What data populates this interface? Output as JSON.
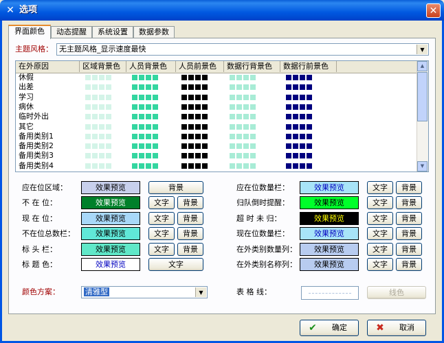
{
  "window": {
    "title": "选项",
    "close": "✕",
    "app_icon": "✕"
  },
  "tabs": [
    "界面颜色",
    "动态提醒",
    "系统设置",
    "数据参数"
  ],
  "theme": {
    "label": "主题风格：",
    "value": "无主题风格_显示速度最快"
  },
  "grid": {
    "columns": [
      "在外原因",
      "区域背景色",
      "人员背景色",
      "人员前景色",
      "数据行背景色",
      "数据行前景色"
    ],
    "rows": [
      "休假",
      "出差",
      "学习",
      "病休",
      "临时外出",
      "其它",
      "备用类别1",
      "备用类别2",
      "备用类别3",
      "备用类别4"
    ],
    "swatch_colors": [
      "#d4f4e8",
      "#33d6a0",
      "#000000",
      "#a8ecd6",
      "#00007f"
    ]
  },
  "left_settings": [
    {
      "label": "应在位区域：",
      "preview": "效果预览",
      "bg": "#c8d0ec",
      "fg": "#000000",
      "buttons": [
        "背景"
      ]
    },
    {
      "label": "不 在 位：",
      "preview": "效果预览",
      "bg": "#00802a",
      "fg": "#ffffff",
      "buttons": [
        "文字",
        "背景"
      ]
    },
    {
      "label": "现 在 位：",
      "preview": "效果预览",
      "bg": "#a8d8f8",
      "fg": "#000000",
      "buttons": [
        "文字",
        "背景"
      ]
    },
    {
      "label": "不在位总数栏：",
      "preview": "效果预览",
      "bg": "#60e8d8",
      "fg": "#000000",
      "buttons": [
        "文字",
        "背景"
      ]
    },
    {
      "label": "标 头 栏：",
      "preview": "效果预览",
      "bg": "#60e8c8",
      "fg": "#000000",
      "buttons": [
        "文字",
        "背景"
      ]
    },
    {
      "label": "标 题 色：",
      "preview": "效果预览",
      "bg": "#ffffff",
      "fg": "#0000c0",
      "buttons": [
        "文字"
      ]
    }
  ],
  "right_settings": [
    {
      "label": "应在位数量栏：",
      "preview": "效果预览",
      "bg": "#a8e4f8",
      "fg": "#0000c0",
      "buttons": [
        "文字",
        "背景"
      ]
    },
    {
      "label": "归队倒时提醒：",
      "preview": "效果预览",
      "bg": "#00ff2a",
      "fg": "#000000",
      "buttons": [
        "文字",
        "背景"
      ]
    },
    {
      "label": "超 时 未 归：",
      "preview": "效果预览",
      "bg": "#000000",
      "fg": "#ffff00",
      "buttons": [
        "文字",
        "背景"
      ]
    },
    {
      "label": "现在位数量栏：",
      "preview": "效果预览",
      "bg": "#a8e4f8",
      "fg": "#0000c0",
      "buttons": [
        "文字",
        "背景"
      ]
    },
    {
      "label": "在外类别数量列：",
      "preview": "效果预览",
      "bg": "#b8ccf0",
      "fg": "#000000",
      "buttons": [
        "文字",
        "背景"
      ]
    },
    {
      "label": "在外类别名称列：",
      "preview": "效果预览",
      "bg": "#b8ccf0",
      "fg": "#000000",
      "buttons": [
        "文字",
        "背景"
      ]
    }
  ],
  "scheme": {
    "label": "颜色方案：",
    "value": "清雅型"
  },
  "gridline": {
    "label": "表 格 线：",
    "button": "线色"
  },
  "footer": {
    "ok": "确定",
    "cancel": "取消",
    "ok_icon": "✔",
    "cancel_icon": "✖"
  }
}
